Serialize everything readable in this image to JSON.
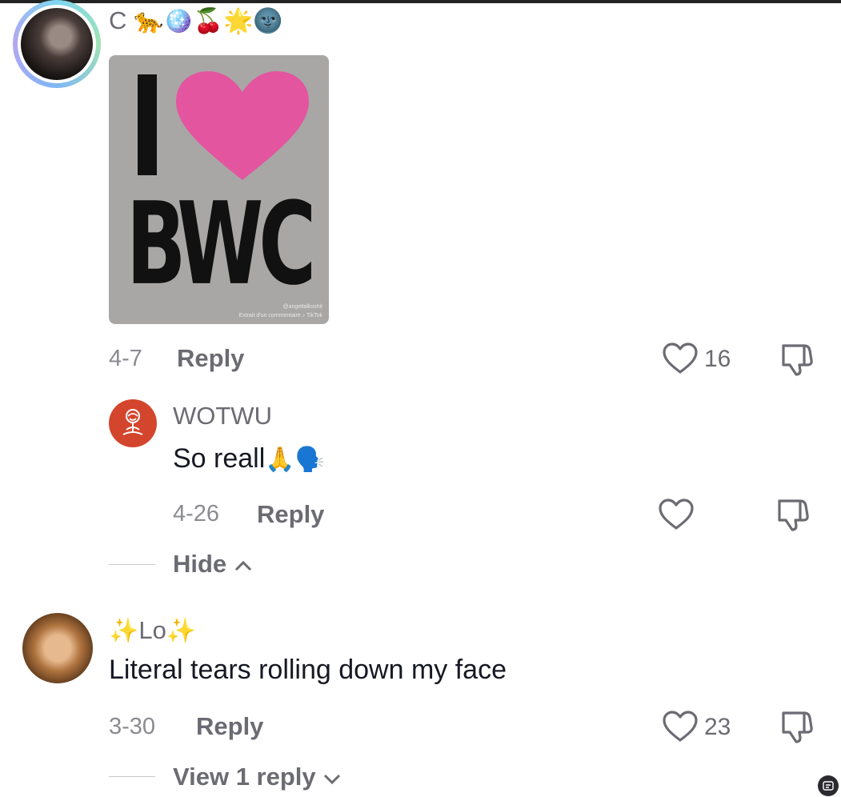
{
  "comment1": {
    "username": "C",
    "username_emojis": "🐆🪩🍒🌟🌚",
    "sticker": {
      "line1": "I",
      "line2": "BWC",
      "watermark_handle": "@angeltalksshit",
      "watermark_note": "Extrait d'un commentaire ♪ TikTok",
      "heart_color": "#e4559f"
    },
    "date": "4-7",
    "reply_label": "Reply",
    "like_count": "16"
  },
  "reply1": {
    "username": "WOTWU",
    "text": "So reall",
    "text_emojis": "🙏🗣️",
    "date": "4-26",
    "reply_label": "Reply"
  },
  "hide_toggle": {
    "label": "Hide",
    "icon": "chevron-up-icon"
  },
  "comment2": {
    "username_sparkle_left": "✨",
    "username": "Lo",
    "username_sparkle_right": "✨",
    "text": "Literal tears rolling down my face",
    "date": "3-30",
    "reply_label": "Reply",
    "like_count": "23"
  },
  "view_replies": {
    "label": "View 1 reply",
    "icon": "chevron-down-icon"
  },
  "colors": {
    "text": "#161823",
    "muted": "#6b6b73",
    "accent_ring": "#7fd6f0"
  }
}
